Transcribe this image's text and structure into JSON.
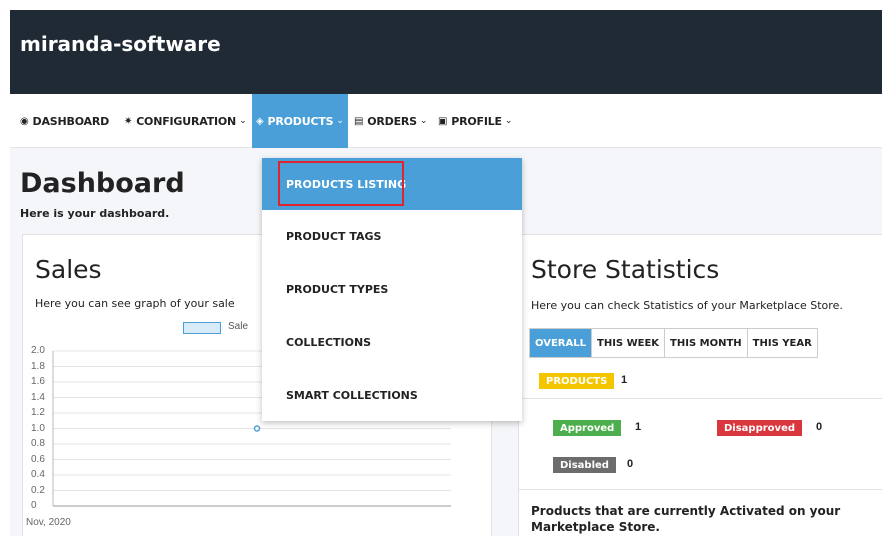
{
  "brand": {
    "name": "miranda-software"
  },
  "nav": {
    "items": [
      {
        "label": "DASHBOARD",
        "icon": "tachometer-icon"
      },
      {
        "label": "CONFIGURATION",
        "icon": "cog-icon"
      },
      {
        "label": "PRODUCTS",
        "icon": "tag-icon"
      },
      {
        "label": "ORDERS",
        "icon": "list-icon"
      },
      {
        "label": "PROFILE",
        "icon": "id-card-icon"
      }
    ]
  },
  "dropdown": {
    "items": [
      "PRODUCTS LISTING",
      "PRODUCT TAGS",
      "PRODUCT TYPES",
      "COLLECTIONS",
      "SMART COLLECTIONS"
    ]
  },
  "page": {
    "title": "Dashboard",
    "subtitle": "Here is your dashboard."
  },
  "sales": {
    "title": "Sales",
    "description": "Here you can see graph of your sale",
    "legend": "Sale"
  },
  "chart_data": {
    "type": "line",
    "series": [
      {
        "name": "Sale",
        "values": [
          1
        ]
      }
    ],
    "categories": [
      "Nov, 2020"
    ],
    "yticks": [
      "2.0",
      "1.8",
      "1.6",
      "1.4",
      "1.2",
      "1.0",
      "0.8",
      "0.6",
      "0.4",
      "0.2",
      "0"
    ],
    "ylim": [
      0,
      2
    ],
    "grid": true,
    "legend_position": "top"
  },
  "stats": {
    "title": "Store Statistics",
    "description": "Here you can check Statistics of your Marketplace Store.",
    "tabs": [
      "OVERALL",
      "THIS WEEK",
      "THIS MONTH",
      "THIS YEAR"
    ],
    "products_label": "PRODUCTS",
    "products_count": "1",
    "approved_label": "Approved",
    "approved_count": "1",
    "disapproved_label": "Disapproved",
    "disapproved_count": "0",
    "disabled_label": "Disabled",
    "disabled_count": "0",
    "activated_text": "Products that are currently Activated on your Marketplace Store."
  },
  "colors": {
    "header_bg": "#1f2a35",
    "accent": "#4a9fd8",
    "products_badge": "#f4c600",
    "approved_badge": "#4cae4c",
    "disapproved_badge": "#d9363e",
    "disabled_badge": "#6c6c6c",
    "highlight_border": "#e0242f"
  }
}
